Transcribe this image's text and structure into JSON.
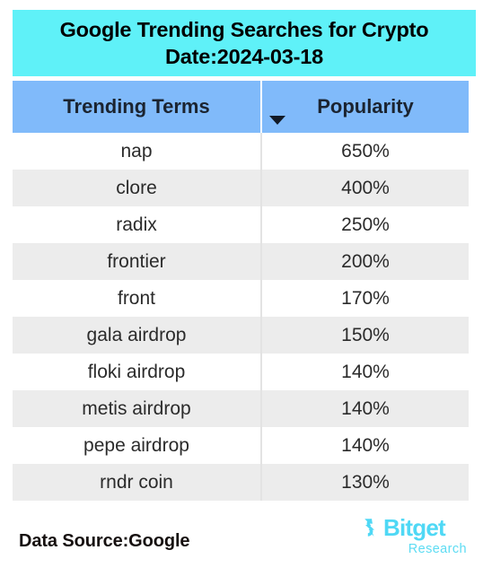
{
  "title": {
    "line1": "Google Trending Searches for Crypto",
    "line2": "Date:2024-03-18"
  },
  "table": {
    "columns": [
      "Trending Terms",
      "Popularity"
    ],
    "sort_indicator": "caret-down",
    "rows": [
      {
        "term": "nap",
        "popularity": "650%"
      },
      {
        "term": "clore",
        "popularity": "400%"
      },
      {
        "term": "radix",
        "popularity": "250%"
      },
      {
        "term": "frontier",
        "popularity": "200%"
      },
      {
        "term": "front",
        "popularity": "170%"
      },
      {
        "term": "gala airdrop",
        "popularity": "150%"
      },
      {
        "term": "floki airdrop",
        "popularity": "140%"
      },
      {
        "term": "metis airdrop",
        "popularity": "140%"
      },
      {
        "term": "pepe airdrop",
        "popularity": "140%"
      },
      {
        "term": "rndr coin",
        "popularity": "130%"
      }
    ]
  },
  "footer": {
    "data_source": "Data Source:Google",
    "brand_name": "Bitget",
    "brand_sub": "Research"
  },
  "colors": {
    "title_banner": "#5FF1F8",
    "header_row": "#80BAFA",
    "row_stripe": "#ECECEC",
    "brand": "#4FD8F5",
    "text": "#2b2b2b"
  },
  "chart_data": {
    "type": "table",
    "title": "Google Trending Searches for Crypto Date:2024-03-18",
    "categories": [
      "nap",
      "clore",
      "radix",
      "frontier",
      "front",
      "gala airdrop",
      "floki airdrop",
      "metis airdrop",
      "pepe airdrop",
      "rndr coin"
    ],
    "values": [
      650,
      400,
      250,
      200,
      170,
      150,
      140,
      140,
      140,
      130
    ],
    "xlabel": "Trending Terms",
    "ylabel": "Popularity",
    "value_unit": "%",
    "sort": "descending by Popularity",
    "source": "Google"
  }
}
